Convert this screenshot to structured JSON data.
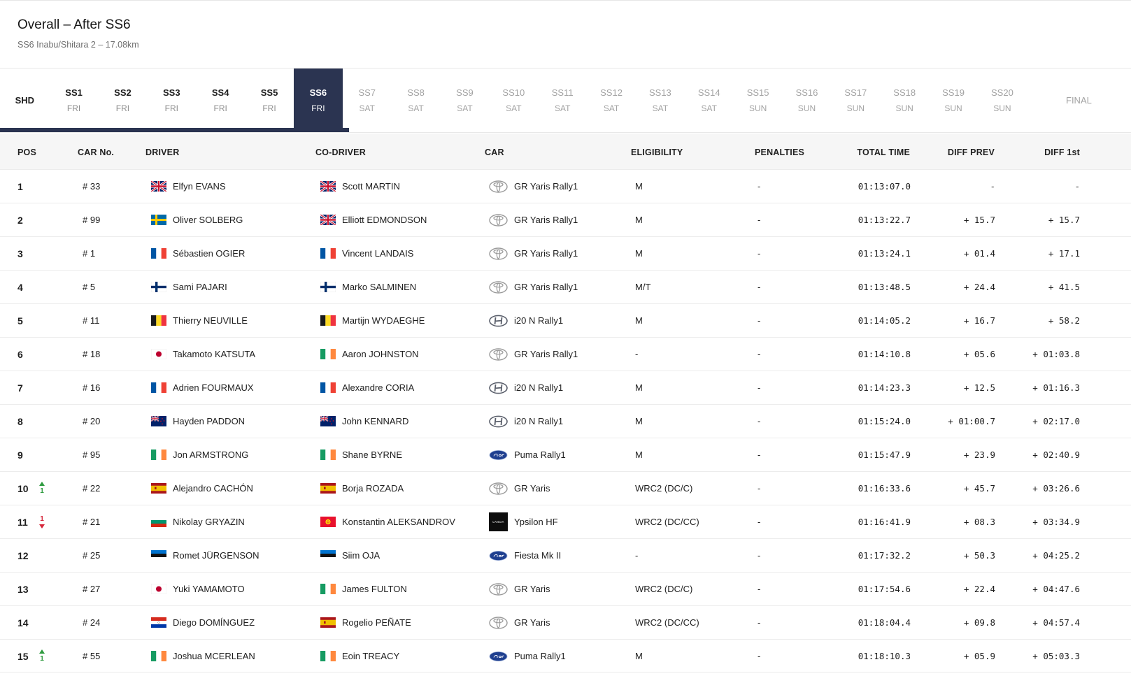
{
  "header": {
    "title": "Overall – After SS6",
    "subtitle": "SS6 Inabu/Shitara 2 – 17.08km"
  },
  "stages": [
    {
      "name": "SHD",
      "day": "",
      "state": "shd"
    },
    {
      "name": "SS1",
      "day": "FRI",
      "state": "done"
    },
    {
      "name": "SS2",
      "day": "FRI",
      "state": "done"
    },
    {
      "name": "SS3",
      "day": "FRI",
      "state": "done"
    },
    {
      "name": "SS4",
      "day": "FRI",
      "state": "done"
    },
    {
      "name": "SS5",
      "day": "FRI",
      "state": "done"
    },
    {
      "name": "SS6",
      "day": "FRI",
      "state": "active"
    },
    {
      "name": "SS7",
      "day": "SAT",
      "state": "future"
    },
    {
      "name": "SS8",
      "day": "SAT",
      "state": "future"
    },
    {
      "name": "SS9",
      "day": "SAT",
      "state": "future"
    },
    {
      "name": "SS10",
      "day": "SAT",
      "state": "future"
    },
    {
      "name": "SS11",
      "day": "SAT",
      "state": "future"
    },
    {
      "name": "SS12",
      "day": "SAT",
      "state": "future"
    },
    {
      "name": "SS13",
      "day": "SAT",
      "state": "future"
    },
    {
      "name": "SS14",
      "day": "SAT",
      "state": "future"
    },
    {
      "name": "SS15",
      "day": "SUN",
      "state": "future"
    },
    {
      "name": "SS16",
      "day": "SUN",
      "state": "future"
    },
    {
      "name": "SS17",
      "day": "SUN",
      "state": "future"
    },
    {
      "name": "SS18",
      "day": "SUN",
      "state": "future"
    },
    {
      "name": "SS19",
      "day": "SUN",
      "state": "future"
    },
    {
      "name": "SS20",
      "day": "SUN",
      "state": "future"
    },
    {
      "name": "FINAL",
      "day": "",
      "state": "future"
    }
  ],
  "columns": {
    "pos": "POS",
    "car_no": "CAR No.",
    "driver": "DRIVER",
    "co_driver": "CO-DRIVER",
    "car": "CAR",
    "eligibility": "ELIGIBILITY",
    "penalties": "PENALTIES",
    "total_time": "TOTAL TIME",
    "diff_prev": "DIFF PREV",
    "diff_first": "DIFF 1st"
  },
  "colors": {
    "accent": "#2b3451",
    "gain": "#2e9b3f",
    "loss": "#d6263a"
  },
  "rows": [
    {
      "pos": "1",
      "move": "",
      "moveDir": "",
      "car_no": "# 33",
      "driver": "Elfyn EVANS",
      "driver_flag": "gb-flag-icon",
      "co_driver": "Scott MARTIN",
      "co_flag": "gb-flag-icon",
      "car": "GR Yaris Rally1",
      "brand": "toyota-logo-icon",
      "eligibility": "M",
      "penalties": "-",
      "total_time": "01:13:07.0",
      "diff_prev": "-",
      "diff_first": "-"
    },
    {
      "pos": "2",
      "move": "",
      "moveDir": "",
      "car_no": "# 99",
      "driver": "Oliver SOLBERG",
      "driver_flag": "se-flag-icon",
      "co_driver": "Elliott EDMONDSON",
      "co_flag": "gb-flag-icon",
      "car": "GR Yaris Rally1",
      "brand": "toyota-logo-icon",
      "eligibility": "M",
      "penalties": "-",
      "total_time": "01:13:22.7",
      "diff_prev": "+ 15.7",
      "diff_first": "+ 15.7"
    },
    {
      "pos": "3",
      "move": "",
      "moveDir": "",
      "car_no": "# 1",
      "driver": "Sébastien OGIER",
      "driver_flag": "fr-flag-icon",
      "co_driver": "Vincent LANDAIS",
      "co_flag": "fr-flag-icon",
      "car": "GR Yaris Rally1",
      "brand": "toyota-logo-icon",
      "eligibility": "M",
      "penalties": "-",
      "total_time": "01:13:24.1",
      "diff_prev": "+ 01.4",
      "diff_first": "+ 17.1"
    },
    {
      "pos": "4",
      "move": "",
      "moveDir": "",
      "car_no": "# 5",
      "driver": "Sami PAJARI",
      "driver_flag": "fi-flag-icon",
      "co_driver": "Marko SALMINEN",
      "co_flag": "fi-flag-icon",
      "car": "GR Yaris Rally1",
      "brand": "toyota-logo-icon",
      "eligibility": "M/T",
      "penalties": "-",
      "total_time": "01:13:48.5",
      "diff_prev": "+ 24.4",
      "diff_first": "+ 41.5"
    },
    {
      "pos": "5",
      "move": "",
      "moveDir": "",
      "car_no": "# 11",
      "driver": "Thierry NEUVILLE",
      "driver_flag": "be-flag-icon",
      "co_driver": "Martijn WYDAEGHE",
      "co_flag": "be-flag-icon",
      "car": "i20 N Rally1",
      "brand": "hyundai-logo-icon",
      "eligibility": "M",
      "penalties": "-",
      "total_time": "01:14:05.2",
      "diff_prev": "+ 16.7",
      "diff_first": "+ 58.2"
    },
    {
      "pos": "6",
      "move": "",
      "moveDir": "",
      "car_no": "# 18",
      "driver": "Takamoto KATSUTA",
      "driver_flag": "jp-flag-icon",
      "co_driver": "Aaron JOHNSTON",
      "co_flag": "ie-flag-icon",
      "car": "GR Yaris Rally1",
      "brand": "toyota-logo-icon",
      "eligibility": "-",
      "penalties": "-",
      "total_time": "01:14:10.8",
      "diff_prev": "+ 05.6",
      "diff_first": "+ 01:03.8"
    },
    {
      "pos": "7",
      "move": "",
      "moveDir": "",
      "car_no": "# 16",
      "driver": "Adrien FOURMAUX",
      "driver_flag": "fr-flag-icon",
      "co_driver": "Alexandre CORIA",
      "co_flag": "fr-flag-icon",
      "car": "i20 N Rally1",
      "brand": "hyundai-logo-icon",
      "eligibility": "M",
      "penalties": "-",
      "total_time": "01:14:23.3",
      "diff_prev": "+ 12.5",
      "diff_first": "+ 01:16.3"
    },
    {
      "pos": "8",
      "move": "",
      "moveDir": "",
      "car_no": "# 20",
      "driver": "Hayden PADDON",
      "driver_flag": "nz-flag-icon",
      "co_driver": "John KENNARD",
      "co_flag": "nz-flag-icon",
      "car": "i20 N Rally1",
      "brand": "hyundai-logo-icon",
      "eligibility": "M",
      "penalties": "-",
      "total_time": "01:15:24.0",
      "diff_prev": "+ 01:00.7",
      "diff_first": "+ 02:17.0"
    },
    {
      "pos": "9",
      "move": "",
      "moveDir": "",
      "car_no": "# 95",
      "driver": "Jon ARMSTRONG",
      "driver_flag": "ie-flag-icon",
      "co_driver": "Shane BYRNE",
      "co_flag": "ie-flag-icon",
      "car": "Puma Rally1",
      "brand": "ford-logo-icon",
      "eligibility": "M",
      "penalties": "-",
      "total_time": "01:15:47.9",
      "diff_prev": "+ 23.9",
      "diff_first": "+ 02:40.9"
    },
    {
      "pos": "10",
      "move": "1",
      "moveDir": "up",
      "car_no": "# 22",
      "driver": "Alejandro CACHÓN",
      "driver_flag": "es-flag-icon",
      "co_driver": "Borja ROZADA",
      "co_flag": "es-flag-icon",
      "car": "GR Yaris",
      "brand": "toyota-logo-icon",
      "eligibility": "WRC2 (DC/C)",
      "penalties": "-",
      "total_time": "01:16:33.6",
      "diff_prev": "+ 45.7",
      "diff_first": "+ 03:26.6"
    },
    {
      "pos": "11",
      "move": "1",
      "moveDir": "down",
      "car_no": "# 21",
      "driver": "Nikolay GRYAZIN",
      "driver_flag": "bg-flag-icon",
      "co_driver": "Konstantin ALEKSANDROV",
      "co_flag": "kg-flag-icon",
      "car": "Ypsilon HF",
      "brand": "lancia-logo-icon",
      "eligibility": "WRC2 (DC/CC)",
      "penalties": "-",
      "total_time": "01:16:41.9",
      "diff_prev": "+ 08.3",
      "diff_first": "+ 03:34.9"
    },
    {
      "pos": "12",
      "move": "",
      "moveDir": "",
      "car_no": "# 25",
      "driver": "Romet JÜRGENSON",
      "driver_flag": "ee-flag-icon",
      "co_driver": "Siim OJA",
      "co_flag": "ee-flag-icon",
      "car": "Fiesta Mk II",
      "brand": "ford-logo-icon",
      "eligibility": "-",
      "penalties": "-",
      "total_time": "01:17:32.2",
      "diff_prev": "+ 50.3",
      "diff_first": "+ 04:25.2"
    },
    {
      "pos": "13",
      "move": "",
      "moveDir": "",
      "car_no": "# 27",
      "driver": "Yuki YAMAMOTO",
      "driver_flag": "jp-flag-icon",
      "co_driver": "James FULTON",
      "co_flag": "ie-flag-icon",
      "car": "GR Yaris",
      "brand": "toyota-logo-icon",
      "eligibility": "WRC2 (DC/C)",
      "penalties": "-",
      "total_time": "01:17:54.6",
      "diff_prev": "+ 22.4",
      "diff_first": "+ 04:47.6"
    },
    {
      "pos": "14",
      "move": "",
      "moveDir": "",
      "car_no": "# 24",
      "driver": "Diego DOMÍNGUEZ",
      "driver_flag": "py-flag-icon",
      "co_driver": "Rogelio PEÑATE",
      "co_flag": "es-flag-icon",
      "car": "GR Yaris",
      "brand": "toyota-logo-icon",
      "eligibility": "WRC2 (DC/CC)",
      "penalties": "-",
      "total_time": "01:18:04.4",
      "diff_prev": "+ 09.8",
      "diff_first": "+ 04:57.4"
    },
    {
      "pos": "15",
      "move": "1",
      "moveDir": "up",
      "car_no": "# 55",
      "driver": "Joshua MCERLEAN",
      "driver_flag": "ie-flag-icon",
      "co_driver": "Eoin TREACY",
      "co_flag": "ie-flag-icon",
      "car": "Puma Rally1",
      "brand": "ford-logo-icon",
      "eligibility": "M",
      "penalties": "-",
      "total_time": "01:18:10.3",
      "diff_prev": "+ 05.9",
      "diff_first": "+ 05:03.3"
    }
  ]
}
